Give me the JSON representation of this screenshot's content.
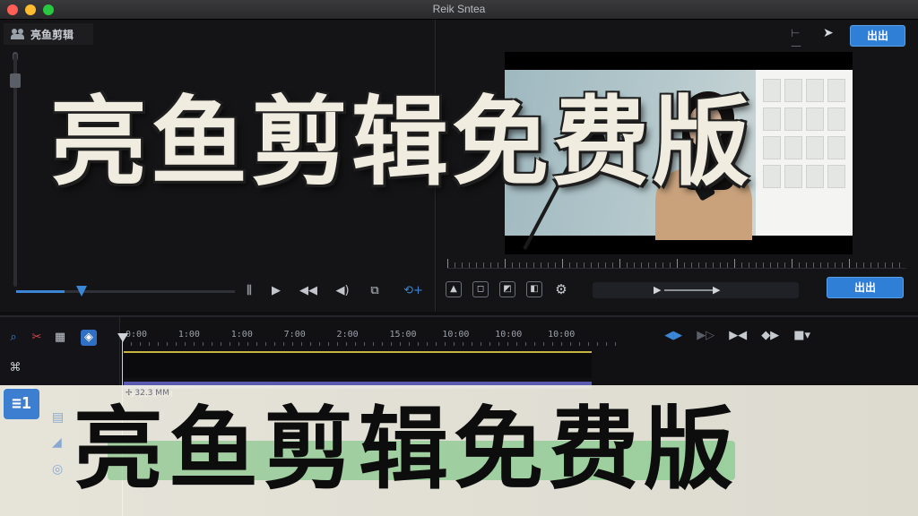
{
  "window": {
    "title": "Reik Sntea"
  },
  "left_panel": {
    "tab_label": "亮鱼剪辑"
  },
  "right_panel": {
    "export_top_label": "出出",
    "export_bottom_label": "出出"
  },
  "timeline": {
    "ruler_labels": [
      "0:00",
      "1:00",
      "1:00",
      "7:00",
      "2:00",
      "15:00",
      "10:00",
      "10:00",
      "10:00"
    ],
    "clip_label": "✢ 32.3 MM",
    "track_badge": "≡1",
    "playhead_fraction": 0.0
  },
  "player": {
    "seek_fraction": 0.22
  },
  "overlay": {
    "headline": "亮鱼剪辑免费版",
    "banner_text": "亮鱼剪辑免费版"
  },
  "colors": {
    "accent": "#2f7fd6",
    "headline": "#f1ece0",
    "banner_bg": "#f4f2e6"
  },
  "icons": [
    "people-icon",
    "pin-icon",
    "play-icon",
    "rewind-icon",
    "volume-icon",
    "loop-icon",
    "gear-icon",
    "search-icon",
    "scissors-icon"
  ]
}
